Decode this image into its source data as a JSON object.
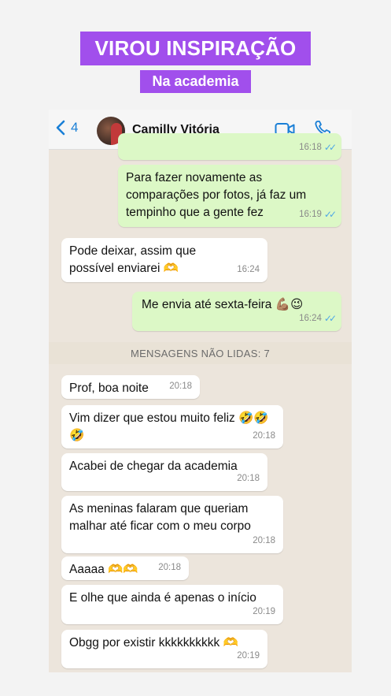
{
  "banner": {
    "title": "VIROU INSPIRAÇÃO",
    "subtitle": "Na academia"
  },
  "header": {
    "back_count": "4",
    "contact_name": "Camilly Vitória"
  },
  "messages": {
    "m0": {
      "time": "16:18"
    },
    "m1": {
      "text": "Para fazer novamente as comparações por fotos, já faz um tempinho que a gente fez",
      "time": "16:19"
    },
    "m2": {
      "text": "Pode deixar, assim que possível enviarei 🫶",
      "time": "16:24"
    },
    "m3": {
      "text": "Me envia até sexta-feira 💪🏽😉",
      "time": "16:24"
    },
    "unread_label": "MENSAGENS NÃO LIDAS: 7",
    "m4": {
      "text": "Prof, boa noite",
      "time": "20:18"
    },
    "m5": {
      "text": "Vim dizer que estou muito feliz 🤣🤣🤣",
      "time": "20:18"
    },
    "m6": {
      "text": "Acabei de chegar da academia",
      "time": "20:18"
    },
    "m7": {
      "text": "As meninas falaram que queriam malhar até ficar com o meu corpo",
      "time": "20:18"
    },
    "m8": {
      "text": "Aaaaa 🫶🫶",
      "time": "20:18"
    },
    "m9": {
      "text": "E olhe que ainda é apenas o início",
      "time": "20:19"
    },
    "m10": {
      "text": "Obgg por existir kkkkkkkkkk 🫶",
      "time": "20:19"
    }
  },
  "colors": {
    "accent": "#a14fec",
    "ios_blue": "#1a7fd6",
    "outgoing_bubble": "#dcf8c6",
    "incoming_bubble": "#ffffff",
    "chat_bg": "#ece5dc"
  },
  "icons": [
    "chevron-left-icon",
    "video-call-icon",
    "phone-icon",
    "read-ticks-icon"
  ]
}
